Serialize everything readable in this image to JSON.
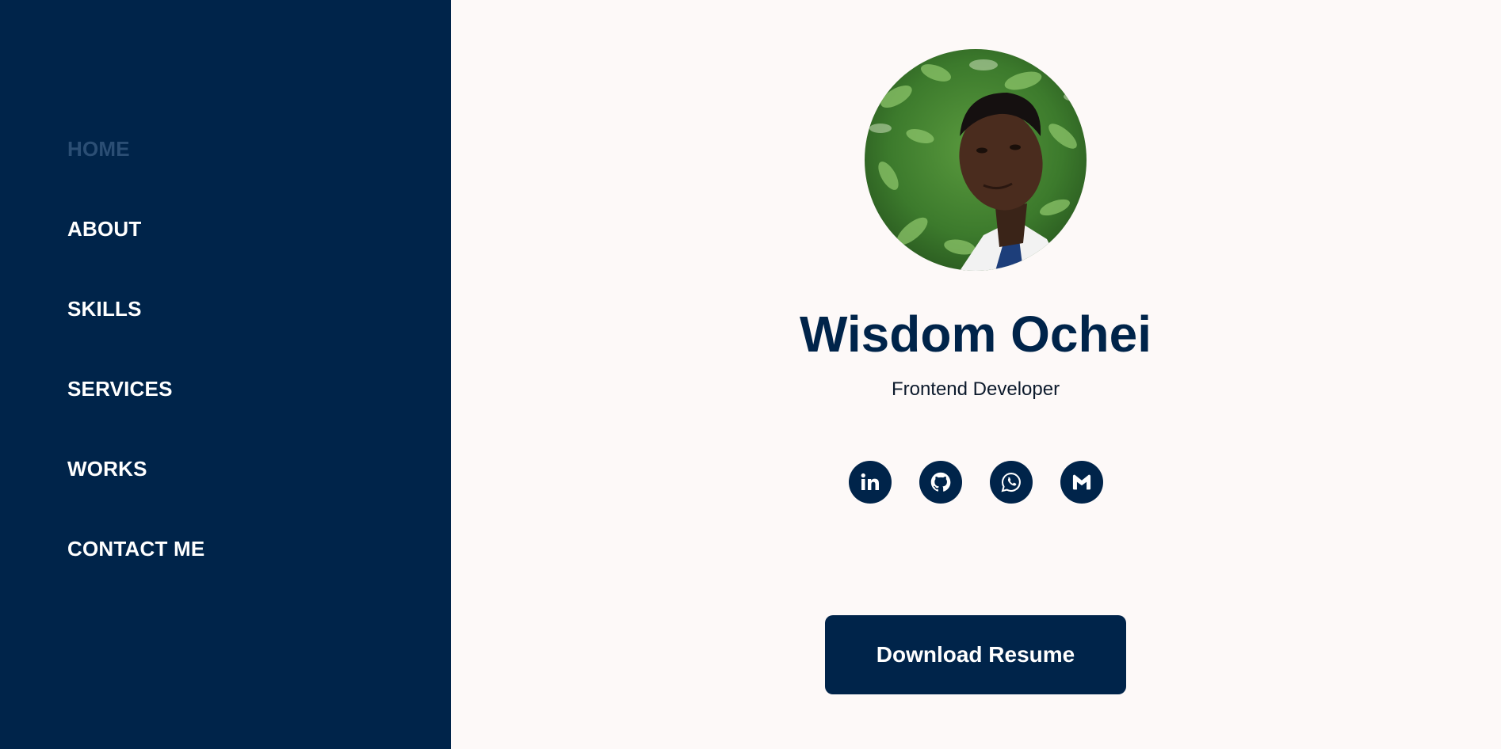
{
  "nav": {
    "items": [
      {
        "label": "HOME",
        "active": true
      },
      {
        "label": "ABOUT",
        "active": false
      },
      {
        "label": "SKILLS",
        "active": false
      },
      {
        "label": "SERVICES",
        "active": false
      },
      {
        "label": "WORKS",
        "active": false
      },
      {
        "label": "CONTACT ME",
        "active": false
      }
    ]
  },
  "profile": {
    "name": "Wisdom Ochei",
    "role": "Frontend Developer",
    "photo_alt": "profile-photo"
  },
  "socials": [
    {
      "icon": "linkedin-icon"
    },
    {
      "icon": "github-icon"
    },
    {
      "icon": "whatsapp-icon"
    },
    {
      "icon": "gmail-icon"
    }
  ],
  "actions": {
    "download_resume_label": "Download Resume"
  },
  "colors": {
    "sidebar_bg": "#00244a",
    "nav_active": "#2b4e74",
    "main_bg": "#fdf9f8",
    "accent": "#00244a"
  }
}
